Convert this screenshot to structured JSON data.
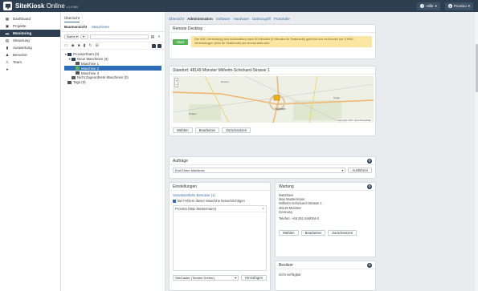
{
  "app": {
    "brand_bold": "SiteKiosk",
    "brand_light": "Online",
    "version": "v.1.0.950"
  },
  "top": {
    "help": "Hilfe",
    "user": "Provisio"
  },
  "sidebar": {
    "items": [
      {
        "label": "Dashboard",
        "icon": "dashboard-icon"
      },
      {
        "label": "Projekte",
        "icon": "briefcase-icon"
      },
      {
        "label": "Monitoring",
        "icon": "monitor-icon",
        "active": true
      },
      {
        "label": "Steuerung",
        "icon": "grid-icon"
      },
      {
        "label": "Auswertung",
        "icon": "bar-chart-icon"
      },
      {
        "label": "Benutzer",
        "icon": "users-icon"
      },
      {
        "label": "Team",
        "icon": "team-icon"
      },
      {
        "label": "",
        "icon": "info-icon"
      }
    ]
  },
  "sub": {
    "tab1": "Übersicht",
    "tab2a": "Baumansicht",
    "tab2b": "Maschinen",
    "filter_select": "Name",
    "tree": [
      {
        "label": "ProvisioTeam (3)",
        "indent": 0,
        "arrow": "▼",
        "color": "#2d3e50"
      },
      {
        "label": "Neue Maschinen (3)",
        "indent": 1,
        "arrow": "▼",
        "color": "#2d3e50"
      },
      {
        "label": "Maschine 1",
        "indent": 2,
        "arrow": "",
        "color": "#555"
      },
      {
        "label": "Maschine 2",
        "indent": 2,
        "arrow": "",
        "color": "#5cb85c",
        "selected": true
      },
      {
        "label": "Maschine 3",
        "indent": 2,
        "arrow": "",
        "color": "#555"
      },
      {
        "label": "Nicht Zugeordnete Maschinen (0)",
        "indent": 1,
        "arrow": "",
        "color": "#555"
      },
      {
        "label": "Tags (0)",
        "indent": 0,
        "arrow": "",
        "color": "#555"
      }
    ]
  },
  "main": {
    "tabs": [
      "Übersicht",
      "Administration",
      "Software",
      "Hardware",
      "Dateizugriff",
      "Protokolle"
    ],
    "active_tab": 1,
    "remote": {
      "title": "Remote Desktop",
      "start": "Start",
      "notice": "Die VNC-Verbindung wird automatisch nach 60 Minuten (5 Minuten für Testkunde) getrennt und es können nur 5 VNC-Verbindungen (eine für Testkunde) auf einmal aktiv sein."
    },
    "location": {
      "title": "Standort: 48149 Münster Wilhelm-Schickard-Strasse 1",
      "copyright": "Copyright 2017 OpenStreetMap",
      "btn_choose": "Wählen",
      "btn_edit": "Bearbeiten",
      "btn_reset": "Zurücksetzen",
      "places": [
        "Münster",
        "Greven",
        "Telgte",
        "Nottuln"
      ]
    },
    "orders": {
      "title": "Aufträge",
      "select": "Erst Einen Machines",
      "btn": "Ausführen"
    },
    "settings": {
      "title": "Einstellungen",
      "resp_label": "Verantwortliche Benutzer (1)",
      "check_label": "Bei Fehlern dieser Maschine benachrichtigen",
      "user_entry": "Provisio (Max Mustermann)",
      "select": "SiteCaster (Torsten Dreher)",
      "add_btn": "Hinzufügen"
    },
    "maintenance": {
      "title": "Wartung",
      "lines": [
        "Wetzstein",
        "Max Mustermann",
        "Wilhelm-Schickard-Strasse 1",
        "48149 Münster",
        "Germany"
      ],
      "phone": "Telefon: +49 251 844004-0",
      "btn_choose": "Wählen",
      "btn_edit": "Bearbeiten",
      "btn_reset": "Zurücksetzen"
    },
    "owner": {
      "title": "Besitzer",
      "text": "nicht verfügbar"
    }
  }
}
